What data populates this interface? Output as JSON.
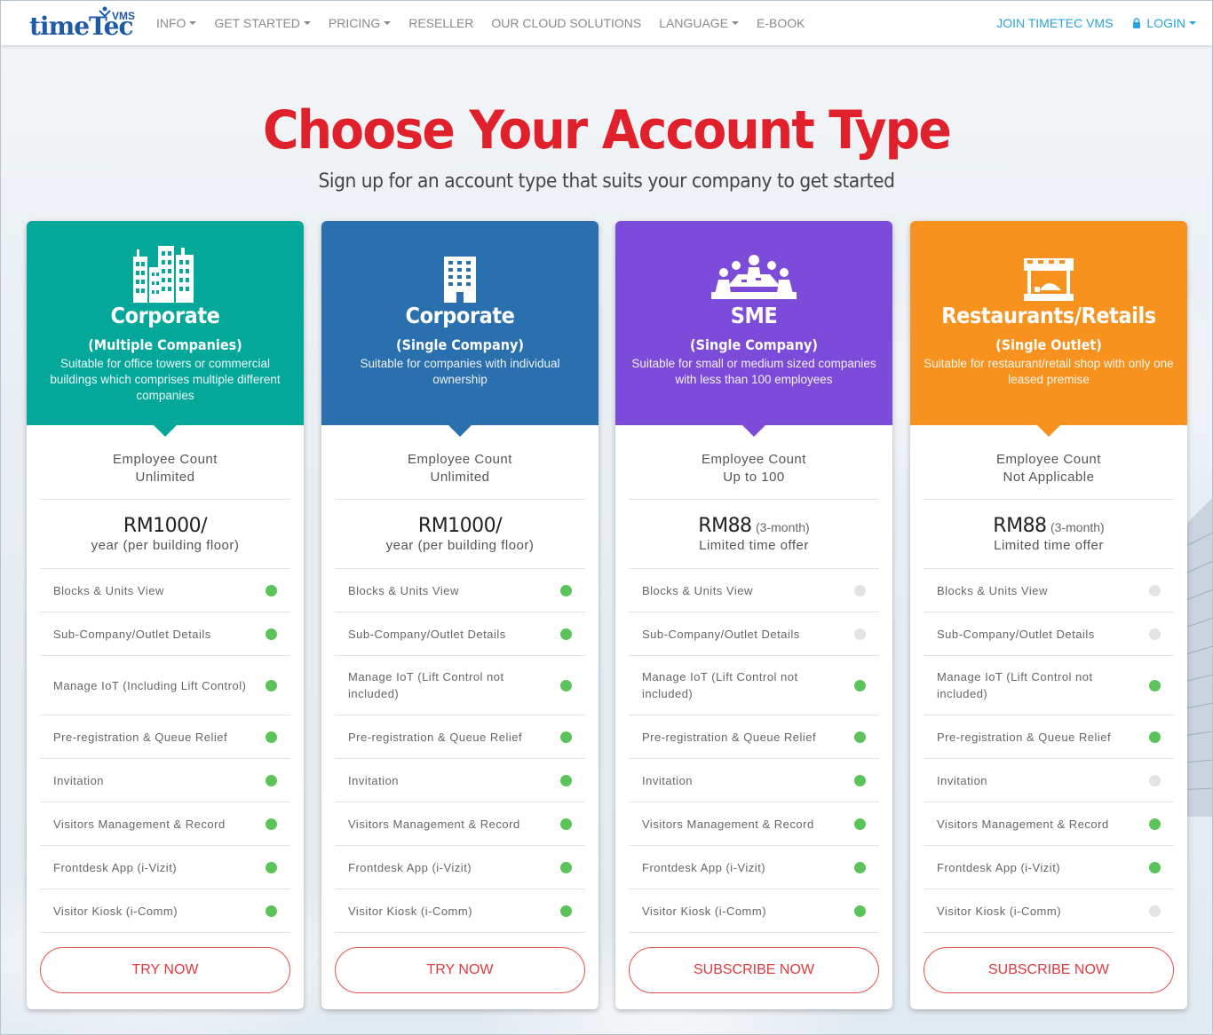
{
  "header": {
    "logo_text": "timeTec",
    "logo_sup": "VMS",
    "nav": [
      {
        "label": "INFO",
        "caret": true
      },
      {
        "label": "GET STARTED",
        "caret": true
      },
      {
        "label": "PRICING",
        "caret": true
      },
      {
        "label": "RESELLER",
        "caret": false
      },
      {
        "label": "OUR CLOUD SOLUTIONS",
        "caret": false
      },
      {
        "label": "LANGUAGE",
        "caret": true
      },
      {
        "label": "E-BOOK",
        "caret": false
      }
    ],
    "join_label": "JOIN TIMETEC VMS",
    "login_label": "LOGIN"
  },
  "hero": {
    "title": "Choose Your Account Type",
    "subtitle": "Sign up for an account type that suits your company to get started"
  },
  "cards": [
    {
      "color": "#04a89a",
      "icon": "city-buildings-icon",
      "title": "Corporate",
      "subtitle": "(Multiple Companies)",
      "description": "Suitable for office towers or commercial buildings which comprises multiple different companies",
      "employee_label": "Employee Count",
      "employee_value": "Unlimited",
      "price": "RM1000/",
      "price_suffix": "",
      "price_note": "year (per building floor)",
      "features": [
        {
          "label": "Blocks & Units View",
          "included": true
        },
        {
          "label": "Sub-Company/Outlet Details",
          "included": true
        },
        {
          "label": "Manage IoT (Including Lift Control)",
          "included": true
        },
        {
          "label": "Pre-registration & Queue Relief",
          "included": true
        },
        {
          "label": "Invitation",
          "included": true
        },
        {
          "label": "Visitors Management & Record",
          "included": true
        },
        {
          "label": "Frontdesk App (i-Vizit)",
          "included": true
        },
        {
          "label": "Visitor Kiosk (i-Comm)",
          "included": true
        }
      ],
      "button": "TRY NOW"
    },
    {
      "color": "#2a6fae",
      "icon": "office-building-icon",
      "title": "Corporate",
      "subtitle": "(Single Company)",
      "description": "Suitable for companies with individual ownership",
      "employee_label": "Employee Count",
      "employee_value": "Unlimited",
      "price": "RM1000/",
      "price_suffix": "",
      "price_note": "year (per building floor)",
      "features": [
        {
          "label": "Blocks & Units View",
          "included": true
        },
        {
          "label": "Sub-Company/Outlet Details",
          "included": true
        },
        {
          "label": "Manage IoT (Lift Control not included)",
          "included": true
        },
        {
          "label": "Pre-registration & Queue Relief",
          "included": true
        },
        {
          "label": "Invitation",
          "included": true
        },
        {
          "label": "Visitors Management & Record",
          "included": true
        },
        {
          "label": "Frontdesk App (i-Vizit)",
          "included": true
        },
        {
          "label": "Visitor Kiosk (i-Comm)",
          "included": true
        }
      ],
      "button": "TRY NOW"
    },
    {
      "color": "#7c4bd9",
      "icon": "meeting-table-icon",
      "title": "SME",
      "subtitle": "(Single Company)",
      "description": "Suitable for small or medium sized companies with less than 100 employees",
      "employee_label": "Employee Count",
      "employee_value": "Up to 100",
      "price": "RM88",
      "price_suffix": "(3-month)",
      "price_note": "Limited time offer",
      "features": [
        {
          "label": "Blocks & Units View",
          "included": false
        },
        {
          "label": "Sub-Company/Outlet Details",
          "included": false
        },
        {
          "label": "Manage IoT (Lift Control not included)",
          "included": true
        },
        {
          "label": "Pre-registration & Queue Relief",
          "included": true
        },
        {
          "label": "Invitation",
          "included": true
        },
        {
          "label": "Visitors Management & Record",
          "included": true
        },
        {
          "label": "Frontdesk App (i-Vizit)",
          "included": true
        },
        {
          "label": "Visitor Kiosk (i-Comm)",
          "included": true
        }
      ],
      "button": "SUBSCRIBE NOW"
    },
    {
      "color": "#f7921e",
      "icon": "shop-stall-icon",
      "title": "Restaurants/Retails",
      "subtitle": "(Single Outlet)",
      "description": "Suitable for restaurant/retail shop with only one leased premise",
      "employee_label": "Employee Count",
      "employee_value": "Not Applicable",
      "price": "RM88",
      "price_suffix": "(3-month)",
      "price_note": "Limited time offer",
      "features": [
        {
          "label": "Blocks & Units View",
          "included": false
        },
        {
          "label": "Sub-Company/Outlet Details",
          "included": false
        },
        {
          "label": "Manage IoT (Lift Control not included)",
          "included": true
        },
        {
          "label": "Pre-registration & Queue Relief",
          "included": true
        },
        {
          "label": "Invitation",
          "included": false
        },
        {
          "label": "Visitors Management & Record",
          "included": true
        },
        {
          "label": "Frontdesk App (i-Vizit)",
          "included": true
        },
        {
          "label": "Visitor Kiosk (i-Comm)",
          "included": false
        }
      ],
      "button": "SUBSCRIBE NOW"
    }
  ]
}
